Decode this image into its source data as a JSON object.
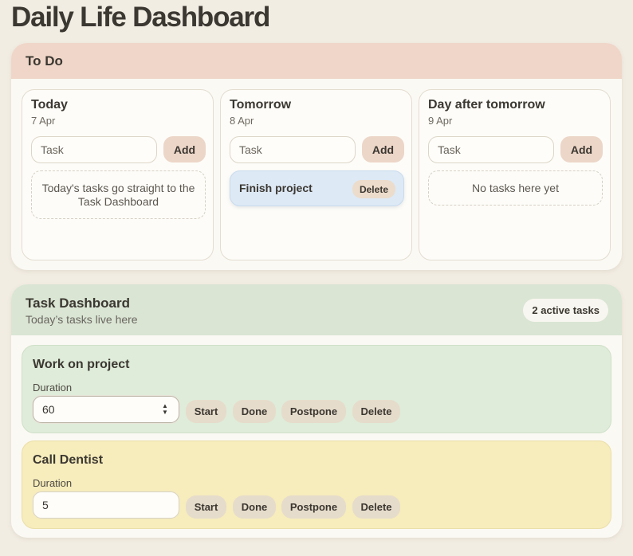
{
  "page": {
    "title": "Daily Life Dashboard"
  },
  "todo": {
    "title": "To Do",
    "days": [
      {
        "name": "Today",
        "date": "7 Apr",
        "input_placeholder": "Task",
        "add_label": "Add",
        "empty_note": "Today's tasks go straight to the Task Dashboard"
      },
      {
        "name": "Tomorrow",
        "date": "8 Apr",
        "input_placeholder": "Task",
        "add_label": "Add",
        "tasks": [
          {
            "title": "Finish project",
            "delete_label": "Delete",
            "color": "#dde9f5"
          }
        ]
      },
      {
        "name": "Day after tomorrow",
        "date": "9 Apr",
        "input_placeholder": "Task",
        "add_label": "Add",
        "empty_note": "No tasks here yet"
      }
    ]
  },
  "dashboard": {
    "title": "Task Dashboard",
    "subtitle": "Today’s tasks live here",
    "active_count_label": "2 active tasks",
    "tasks": [
      {
        "title": "Work on project",
        "duration_label": "Duration",
        "duration_value": "60",
        "color": "#deecd9",
        "buttons": {
          "start": "Start",
          "done": "Done",
          "postpone": "Postpone",
          "delete": "Delete"
        }
      },
      {
        "title": "Call Dentist",
        "duration_label": "Duration",
        "duration_value": "5",
        "color": "#f6ecbc",
        "buttons": {
          "start": "Start",
          "done": "Done",
          "postpone": "Postpone",
          "delete": "Delete"
        }
      }
    ]
  },
  "colors": {
    "background": "#f2ede3",
    "todo_header": "#efd6c8",
    "dashboard_header": "#dae5d4",
    "button": "#e6dccb",
    "add_button": "#ecd6c8"
  }
}
